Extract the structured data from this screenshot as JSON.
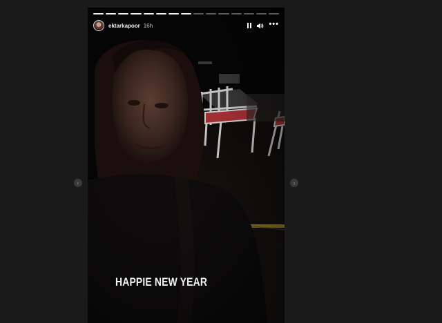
{
  "story": {
    "progress": {
      "segments": 15,
      "completed": 8
    },
    "user": {
      "username": "ektarkapoor",
      "time_ago": "16h"
    },
    "controls": {
      "pause_icon": "pause-icon",
      "sound_icon": "speaker-icon",
      "more_icon": "more-options-icon",
      "more_label": "•••"
    },
    "caption": "HAPPIE NEW YEAR"
  },
  "nav": {
    "prev_label": "‹",
    "next_label": "›"
  },
  "colors": {
    "background": "#1a1a1a",
    "story_bg": "#060606",
    "yellow_line": "#b8961e",
    "chair_cushion": "#b0343a"
  }
}
